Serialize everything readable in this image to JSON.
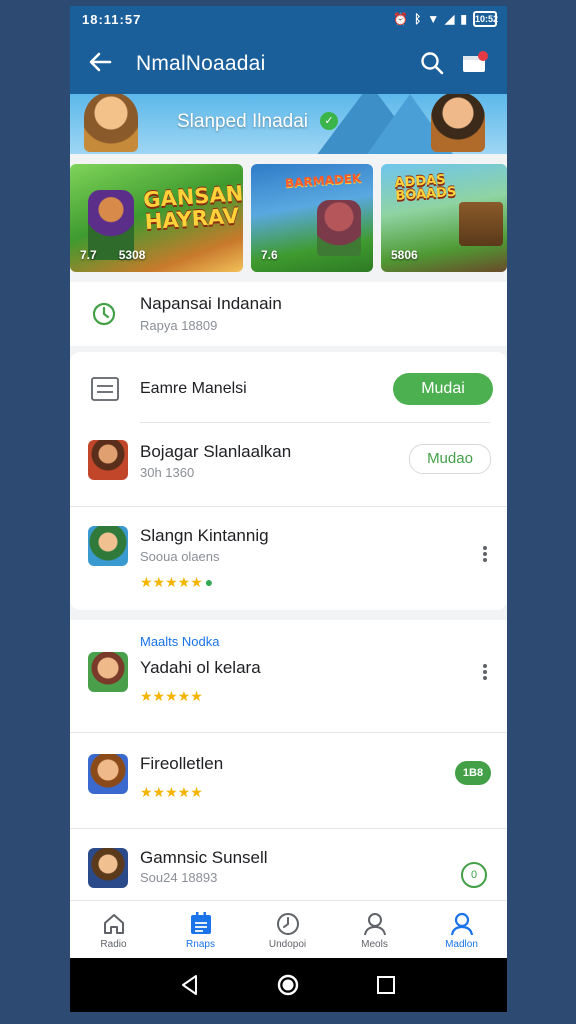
{
  "status": {
    "time": "18:11:57",
    "battery": "10:52"
  },
  "appbar": {
    "title": "NmalNoaadai",
    "back_icon": "arrow-left-icon",
    "search_icon": "search-icon",
    "notification_icon": "notification-icon"
  },
  "banner": {
    "text": "Slanped Ilnadai"
  },
  "featured": [
    {
      "logo": "GANSAN HAYRAV",
      "rating": "7.7",
      "downloads": "5308"
    },
    {
      "logo": "BARMADEK",
      "rating": "7.6",
      "downloads": ""
    },
    {
      "logo": "ADDAS BOAADS",
      "rating": "",
      "downloads": "5806"
    }
  ],
  "recent": {
    "title": "Napansai Indanain",
    "subtitle": "Rapya 18809"
  },
  "panel": {
    "header": {
      "title": "Eamre Manelsi",
      "button": "Mudai"
    },
    "items": [
      {
        "title": "Bojagar Slanlaalkan",
        "subtitle": "30h 1360",
        "button": "Mudao"
      },
      {
        "title": "Slangn Kintannig",
        "subtitle": "Sooua olaens",
        "stars": "★★★★★"
      }
    ]
  },
  "section": {
    "label": "Maalts Nodka",
    "items": [
      {
        "title": "Yadahi ol kelara",
        "stars": "★★★★★"
      },
      {
        "title": "Fireolletlen",
        "stars": "★★★★★",
        "badge": "1B8"
      },
      {
        "title": "Gamnsic Sunsell",
        "subtitle": "Sou24 18893",
        "badge": "0"
      }
    ]
  },
  "bottom_nav": [
    {
      "label": "Radio",
      "icon": "home-icon"
    },
    {
      "label": "Rnaps",
      "icon": "apps-icon"
    },
    {
      "label": "Undopoi",
      "icon": "clock-icon"
    },
    {
      "label": "Meols",
      "icon": "profile-icon"
    },
    {
      "label": "Madlon",
      "icon": "account-icon"
    }
  ],
  "colors": {
    "primary": "#1b5f9a",
    "accent": "#4caf50",
    "link": "#1a73e8",
    "star": "#f4b400"
  }
}
